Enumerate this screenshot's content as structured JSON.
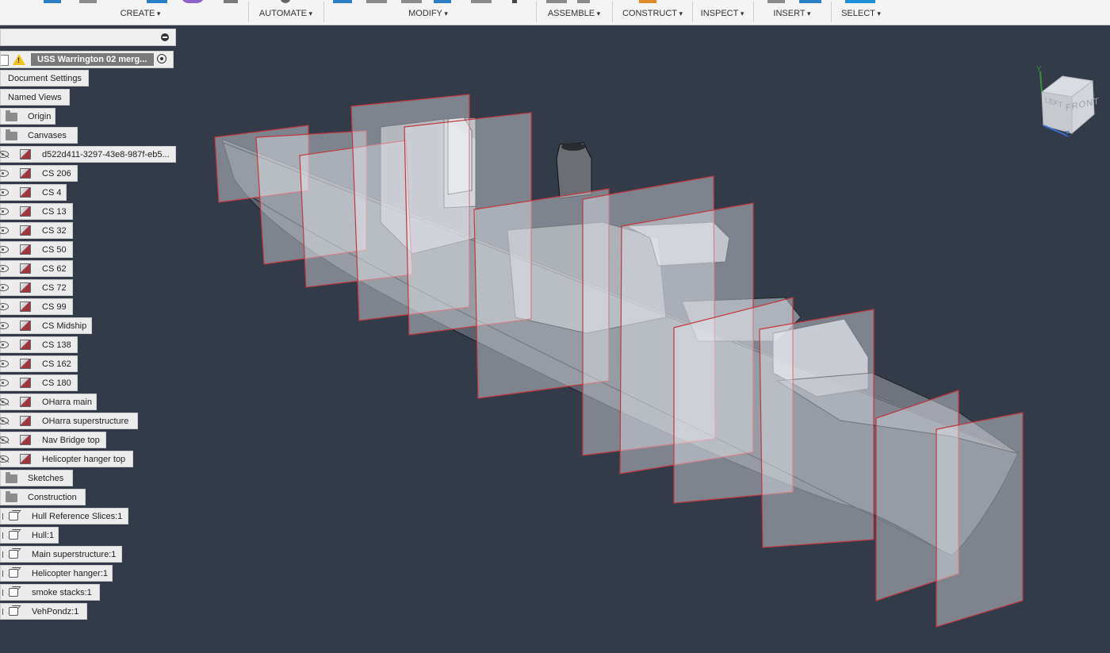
{
  "toolbar": {
    "groups": [
      {
        "label": "CREATE"
      },
      {
        "label": "AUTOMATE"
      },
      {
        "label": "MODIFY"
      },
      {
        "label": "ASSEMBLE"
      },
      {
        "label": "CONSTRUCT"
      },
      {
        "label": "INSPECT"
      },
      {
        "label": "INSERT"
      },
      {
        "label": "SELECT"
      }
    ]
  },
  "browser": {
    "root": {
      "label": "USS Warrington 02 merg...",
      "icons": [
        "document-icon",
        "warning-icon",
        "activate-target-icon"
      ]
    },
    "items": [
      {
        "label": "Document Settings"
      },
      {
        "label": "Named Views"
      },
      {
        "label": "Origin",
        "icon": "folder-icon"
      },
      {
        "label": "Canvases",
        "icon": "folder-icon"
      }
    ],
    "canvases": [
      {
        "label": "d522d411-3297-43e8-987f-eb5...",
        "visible": false
      },
      {
        "label": "CS 206",
        "visible": true
      },
      {
        "label": "CS 4",
        "visible": true
      },
      {
        "label": "CS 13",
        "visible": true
      },
      {
        "label": "CS 32",
        "visible": true
      },
      {
        "label": "CS 50",
        "visible": true
      },
      {
        "label": "CS 62",
        "visible": true
      },
      {
        "label": "CS 72",
        "visible": true
      },
      {
        "label": "CS 99",
        "visible": true
      },
      {
        "label": "CS Midship",
        "visible": true
      },
      {
        "label": "CS 138",
        "visible": true
      },
      {
        "label": "CS 162",
        "visible": true
      },
      {
        "label": "CS 180",
        "visible": true
      },
      {
        "label": "OHarra main",
        "visible": false
      },
      {
        "label": "OHarra superstructure",
        "visible": false
      },
      {
        "label": "Nav Bridge top",
        "visible": false
      },
      {
        "label": "Helicopter hanger top",
        "visible": false
      }
    ],
    "folders": [
      {
        "label": "Sketches",
        "icon": "folder-icon"
      },
      {
        "label": "Construction",
        "icon": "folder-icon"
      }
    ],
    "bodies": [
      {
        "label": "Hull Reference Slices:1",
        "icon": "component-icon"
      },
      {
        "label": "Hull:1",
        "icon": "component-icon"
      },
      {
        "label": "Main superstructure:1",
        "icon": "component-link-icon"
      },
      {
        "label": "Helicopter hanger:1",
        "icon": "component-icon"
      },
      {
        "label": "smoke stacks:1",
        "icon": "component-icon"
      },
      {
        "label": "VehPondz:1",
        "icon": "component-icon"
      }
    ]
  },
  "viewcube": {
    "face_front": "FRONT",
    "face_left": "LEFT",
    "axis_y": "Y",
    "axis_z": "Z"
  },
  "colors": {
    "viewport_bg": "#333b48",
    "canvas_border": "#c0393f",
    "panel_bg": "#ececec",
    "toolbar_bg": "#f4f4f4",
    "select_accent": "#1e8fd6"
  }
}
